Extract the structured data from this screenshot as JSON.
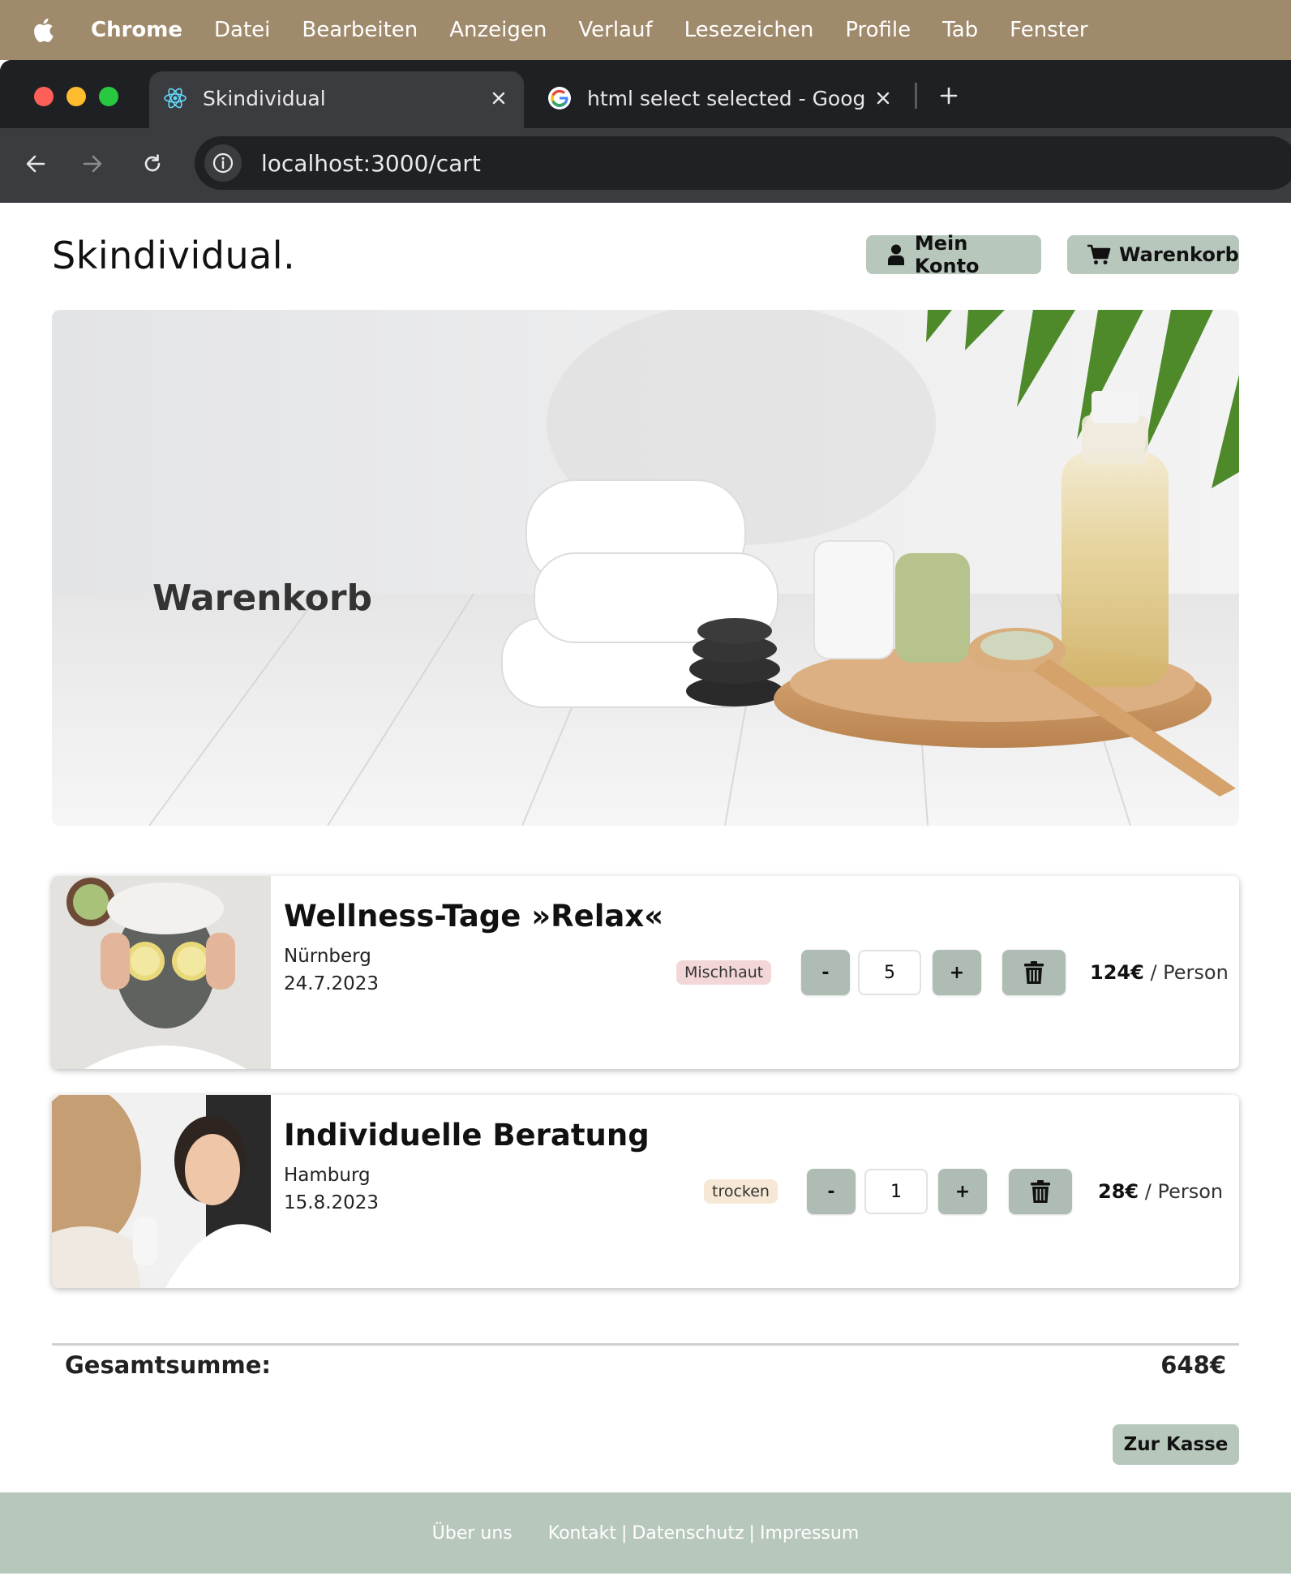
{
  "menubar": {
    "items": [
      "Chrome",
      "Datei",
      "Bearbeiten",
      "Anzeigen",
      "Verlauf",
      "Lesezeichen",
      "Profile",
      "Tab",
      "Fenster"
    ]
  },
  "browser": {
    "tabs": [
      {
        "label": "Skindividual",
        "icon": "react-icon"
      },
      {
        "label": "html select selected - Google",
        "icon": "google-icon"
      }
    ],
    "url": "localhost:3000/cart"
  },
  "header": {
    "brand": "Skindividual.",
    "account_label": "Mein Konto",
    "cart_label": "Warenkorb"
  },
  "hero": {
    "title": "Warenkorb"
  },
  "cart": {
    "items": [
      {
        "name": "Wellness-Tage »Relax«",
        "city": "Nürnberg",
        "date": "24.7.2023",
        "skin_type": "Mischhaut",
        "badge_color": "#f2d6d8",
        "quantity": "5",
        "price": "124€",
        "price_unit": "/ Person"
      },
      {
        "name": "Individuelle Beratung",
        "city": "Hamburg",
        "date": "15.8.2023",
        "skin_type": "trocken",
        "badge_color": "#f6e8d4",
        "quantity": "1",
        "price": "28€",
        "price_unit": "/ Person"
      }
    ],
    "minus_label": "-",
    "plus_label": "+",
    "total_label": "Gesamtsumme:",
    "total_value": "648€",
    "checkout_label": "Zur Kasse"
  },
  "footer": {
    "about": "Über uns",
    "contact": "Kontakt",
    "privacy": "Datenschutz",
    "imprint": "Impressum",
    "separator": "|"
  },
  "colors": {
    "menubar": "#a08a6c",
    "accent_button": "#b8c7bc",
    "footer": "#b8c7bc"
  }
}
